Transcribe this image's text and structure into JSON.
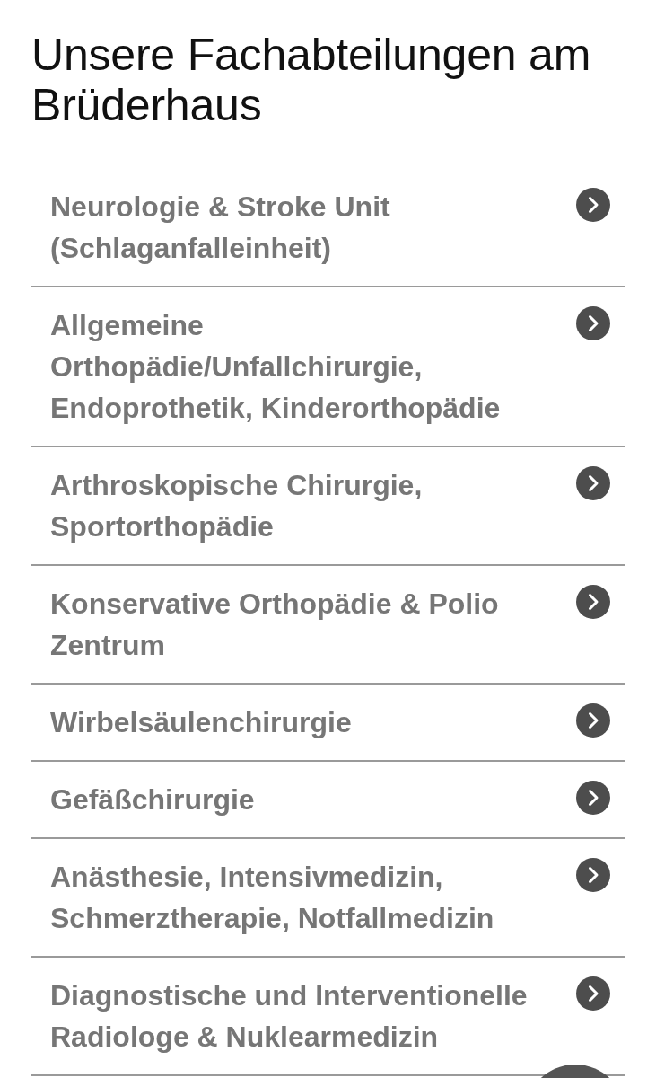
{
  "page": {
    "title": "Unsere Fachabteilungen am Brüderhaus"
  },
  "departments": [
    {
      "label": "Neurologie & Stroke Unit (Schlaganfalleinheit)"
    },
    {
      "label": "Allgemeine Orthopädie/Unfallchirurgie, Endoprothetik, Kinderorthopädie"
    },
    {
      "label": "Arthroskopische Chirurgie, Sportorthopädie"
    },
    {
      "label": "Konservative Orthopädie & Polio Zentrum"
    },
    {
      "label": "Wirbelsäulenchirurgie"
    },
    {
      "label": "Gefäßchirurgie"
    },
    {
      "label": "Anästhesie, Intensivmedizin, Schmerztherapie, Notfallmedizin"
    },
    {
      "label": "Diagnostische und Interventionelle Radiologe & Nuklearmedizin"
    }
  ]
}
